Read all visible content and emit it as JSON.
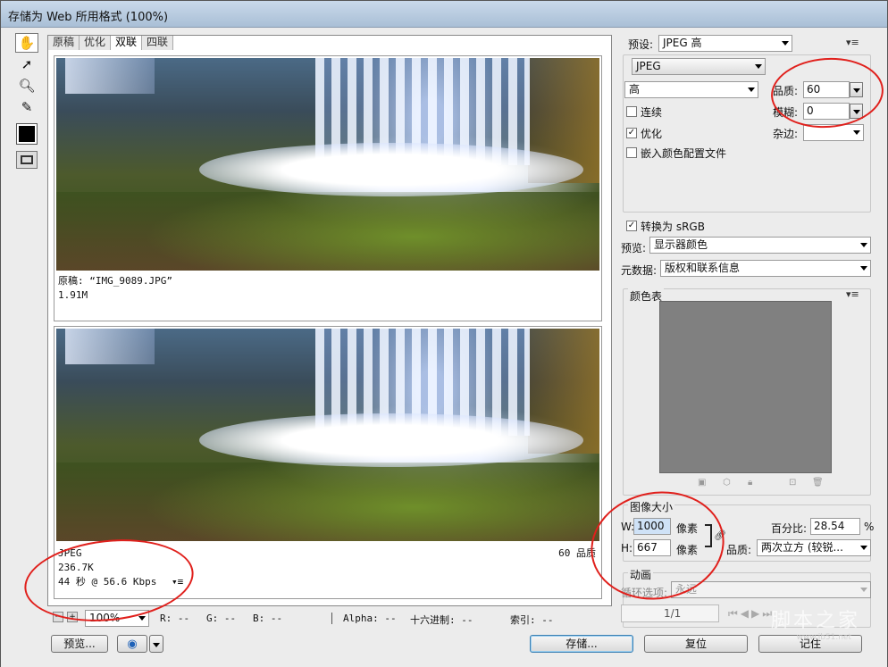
{
  "window": {
    "title": "存储为 Web 所用格式 (100%)"
  },
  "tabs": [
    "原稿",
    "优化",
    "双联",
    "四联"
  ],
  "original": {
    "label": "原稿: “IMG_9089.JPG”",
    "size": "1.91M"
  },
  "optimized": {
    "format": "JPEG",
    "size": "236.7K",
    "time": "44 秒 @ 56.6 Kbps",
    "quality_note": "60 品质"
  },
  "settings": {
    "preset_label": "预设:",
    "preset_value": "JPEG 高",
    "format_value": "JPEG",
    "compression_value": "高",
    "quality_label": "品质:",
    "quality_value": "60",
    "blur_label": "模糊:",
    "blur_value": "0",
    "matte_label": "杂边:",
    "matte_value": "",
    "progressive_label": "连续",
    "optimized_label": "优化",
    "embed_profile_label": "嵌入颜色配置文件",
    "convert_srgb_label": "转换为 sRGB",
    "preview_label": "预览:",
    "preview_value": "显示器颜色",
    "metadata_label": "元数据:",
    "metadata_value": "版权和联系信息"
  },
  "color_table": {
    "title": "颜色表"
  },
  "image_size": {
    "title": "图像大小",
    "w_label": "W:",
    "w_value": "1000",
    "h_label": "H:",
    "h_value": "667",
    "unit": "像素",
    "percent_label": "百分比:",
    "percent_value": "28.54",
    "percent_sign": "%",
    "quality_label": "品质:",
    "quality_value": "两次立方 (较锐..."
  },
  "animation": {
    "title": "动画",
    "loop_label": "循环选项:",
    "loop_value": "永远",
    "frame": "1/1"
  },
  "status": {
    "zoom": "100%",
    "r": "R: --",
    "g": "G: --",
    "b": "B: --",
    "alpha": "Alpha: --",
    "hex": "十六进制: --",
    "index": "索引: --"
  },
  "buttons": {
    "preview": "预览...",
    "save": "存储...",
    "reset": "复位",
    "remember": "记住"
  },
  "watermark": {
    "text": "脚本之家",
    "sub": "www.jb51.net"
  }
}
